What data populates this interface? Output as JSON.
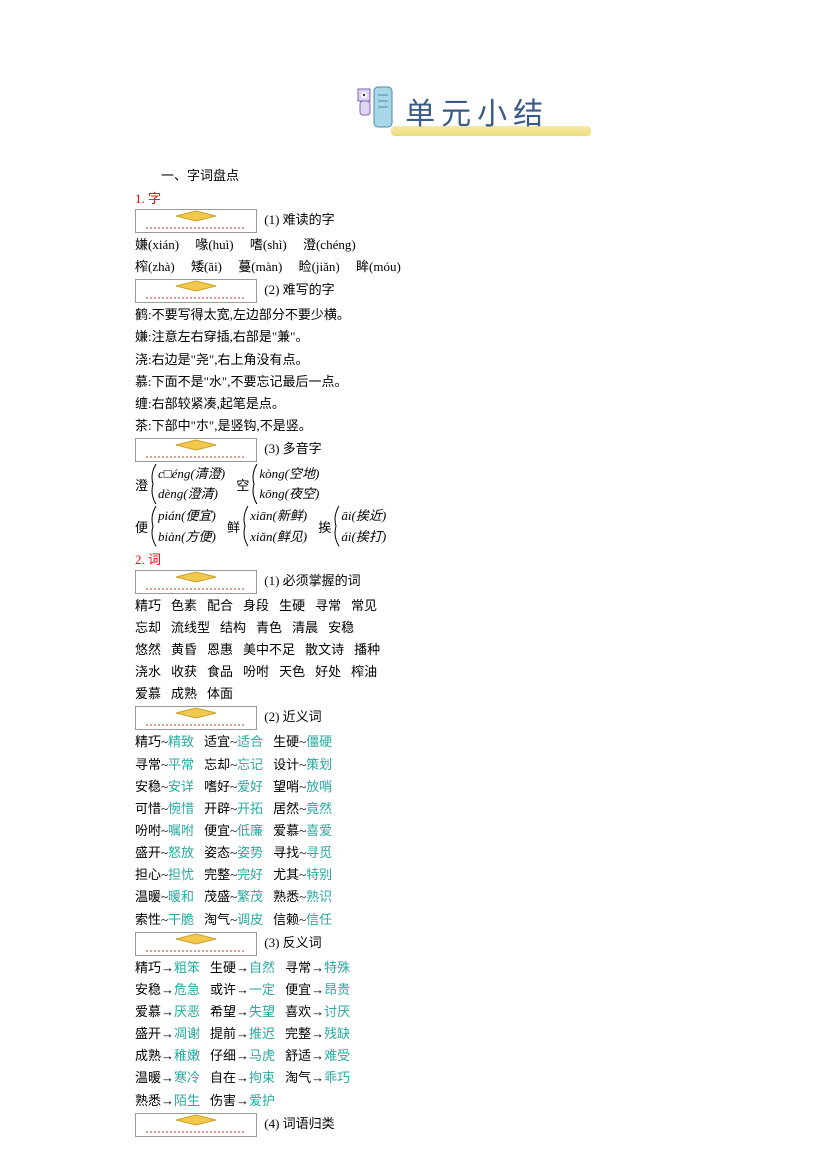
{
  "title": "单元小结",
  "section_main": "一、字词盘点",
  "char_section": {
    "num": "1. 字",
    "sub1": "(1) 难读的字",
    "hard_read": [
      [
        "嫌(xián)",
        "喙(huì)",
        "嗜(shì)",
        "澄(chéng)"
      ],
      [
        "榨(zhà)",
        "矮(ǎi)",
        "蔓(màn)",
        "睑(jiǎn)",
        "眸(móu)"
      ]
    ],
    "sub2": "(2) 难写的字",
    "hard_write": [
      "鹤:不要写得太宽,左边部分不要少横。",
      "嫌:注意左右穿插,右部是\"兼\"。",
      "浇:右边是\"尧\",右上角没有点。",
      "慕:下面不是\"水\",不要忘记最后一点。",
      "缠:右部较紧凑,起笔是点。",
      "茶:下部中\"朩\",是竖钩,不是竖。"
    ],
    "sub3": "(3) 多音字",
    "poly": {
      "row1": [
        {
          "label": "澄",
          "items": [
            "c□éng(清澄)",
            "dèng(澄清)"
          ]
        },
        {
          "label": "空",
          "items": [
            "kòng(空地)",
            "kōng(夜空)"
          ]
        }
      ],
      "row2": [
        {
          "label": "便",
          "items": [
            "pián(便宜)",
            "biàn(方便)"
          ]
        },
        {
          "label": "鲜",
          "items": [
            "xiān(新鲜)",
            "xiǎn(鲜见)"
          ]
        },
        {
          "label": "挨",
          "items": [
            "āi(挨近)",
            "ái(挨打)"
          ]
        }
      ]
    }
  },
  "word_section": {
    "num": "2. 词",
    "sub1": "(1) 必须掌握的词",
    "must_words": [
      [
        "精巧",
        "色素",
        "配合",
        "身段",
        "生硬",
        "寻常",
        "常见"
      ],
      [
        "忘却",
        "流线型",
        "结构",
        "青色",
        "清晨",
        "安稳"
      ],
      [
        "悠然",
        "黄昏",
        "恩惠",
        "美中不足",
        "散文诗",
        "播种"
      ],
      [
        "浇水",
        "收获",
        "食品",
        "吩咐",
        "天色",
        "好处",
        "榨油"
      ],
      [
        "爱慕",
        "成熟",
        "体面"
      ]
    ],
    "sub2": "(2) 近义词",
    "synonyms": [
      [
        [
          "精巧",
          "精致"
        ],
        [
          "适宜",
          "适合"
        ],
        [
          "生硬",
          "僵硬"
        ]
      ],
      [
        [
          "寻常",
          "平常"
        ],
        [
          "忘却",
          "忘记"
        ],
        [
          "设计",
          "策划"
        ]
      ],
      [
        [
          "安稳",
          "安详"
        ],
        [
          "嗜好",
          "爱好"
        ],
        [
          "望哨",
          "放哨"
        ]
      ],
      [
        [
          "可惜",
          "惋惜"
        ],
        [
          "开辟",
          "开拓"
        ],
        [
          "居然",
          "竟然"
        ]
      ],
      [
        [
          "吩咐",
          "嘱咐"
        ],
        [
          "便宜",
          "低廉"
        ],
        [
          "爱慕",
          "喜爱"
        ]
      ],
      [
        [
          "盛开",
          "怒放"
        ],
        [
          "姿态",
          "姿势"
        ],
        [
          "寻找",
          "寻觅"
        ]
      ],
      [
        [
          "担心",
          "担忧"
        ],
        [
          "完整",
          "完好"
        ],
        [
          "尤其",
          "特别"
        ]
      ],
      [
        [
          "温暖",
          "暖和"
        ],
        [
          "茂盛",
          "繁茂"
        ],
        [
          "熟悉",
          "熟识"
        ]
      ],
      [
        [
          "索性",
          "干脆"
        ],
        [
          "淘气",
          "调皮"
        ],
        [
          "信赖",
          "信任"
        ]
      ]
    ],
    "sub3": "(3) 反义词",
    "antonyms": [
      [
        [
          "精巧",
          "粗笨"
        ],
        [
          "生硬",
          "自然"
        ],
        [
          "寻常",
          "特殊"
        ]
      ],
      [
        [
          "安稳",
          "危急"
        ],
        [
          "或许",
          "一定"
        ],
        [
          "便宜",
          "昂贵"
        ]
      ],
      [
        [
          "爱慕",
          "厌恶"
        ],
        [
          "希望",
          "失望"
        ],
        [
          "喜欢",
          "讨厌"
        ]
      ],
      [
        [
          "盛开",
          "凋谢"
        ],
        [
          "提前",
          "推迟"
        ],
        [
          "完整",
          "残缺"
        ]
      ],
      [
        [
          "成熟",
          "稚嫩"
        ],
        [
          "仔细",
          "马虎"
        ],
        [
          "舒适",
          "难受"
        ]
      ],
      [
        [
          "温暖",
          "寒冷"
        ],
        [
          "自在",
          "拘束"
        ],
        [
          "淘气",
          "乖巧"
        ]
      ],
      [
        [
          "熟悉",
          "陌生"
        ],
        [
          "伤害",
          "爱护"
        ]
      ]
    ],
    "sub4": "(4) 词语归类"
  }
}
